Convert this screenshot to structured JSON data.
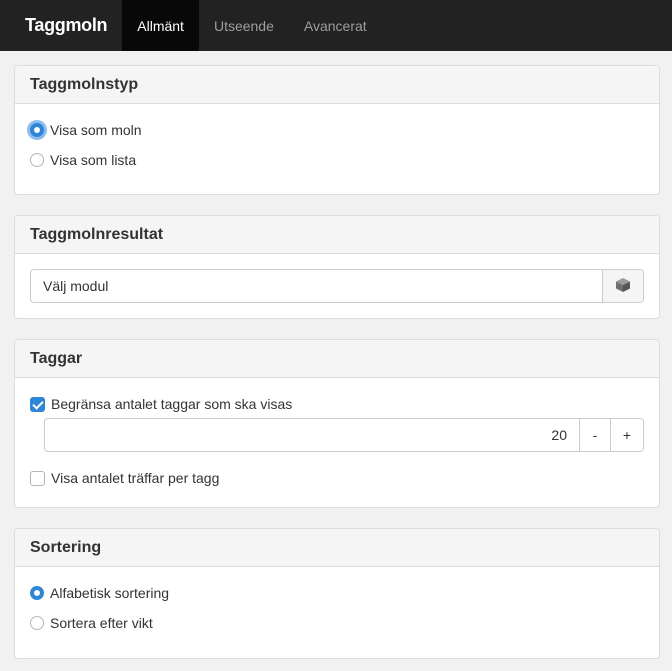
{
  "header": {
    "title": "Taggmoln",
    "tabs": [
      {
        "label": "Allmänt",
        "active": true
      },
      {
        "label": "Utseende",
        "active": false
      },
      {
        "label": "Avancerat",
        "active": false
      }
    ]
  },
  "type_panel": {
    "heading": "Taggmolnstyp",
    "options": [
      {
        "label": "Visa som moln",
        "selected": true
      },
      {
        "label": "Visa som lista",
        "selected": false
      }
    ]
  },
  "result_panel": {
    "heading": "Taggmolnresultat",
    "module_value": "Välj modul",
    "icon": "cube-icon"
  },
  "tags_panel": {
    "heading": "Taggar",
    "limit_label": "Begränsa antalet taggar som ska visas",
    "limit_checked": true,
    "limit_value": "20",
    "decrement_label": "-",
    "increment_label": "+",
    "hits_label": "Visa antalet träffar per tagg",
    "hits_checked": false
  },
  "sort_panel": {
    "heading": "Sortering",
    "options": [
      {
        "label": "Alfabetisk sortering",
        "selected": true
      },
      {
        "label": "Sortera efter vikt",
        "selected": false
      }
    ]
  },
  "colors": {
    "topbar": "#222222",
    "active_tab": "#080808",
    "accent": "#2f86d6"
  }
}
